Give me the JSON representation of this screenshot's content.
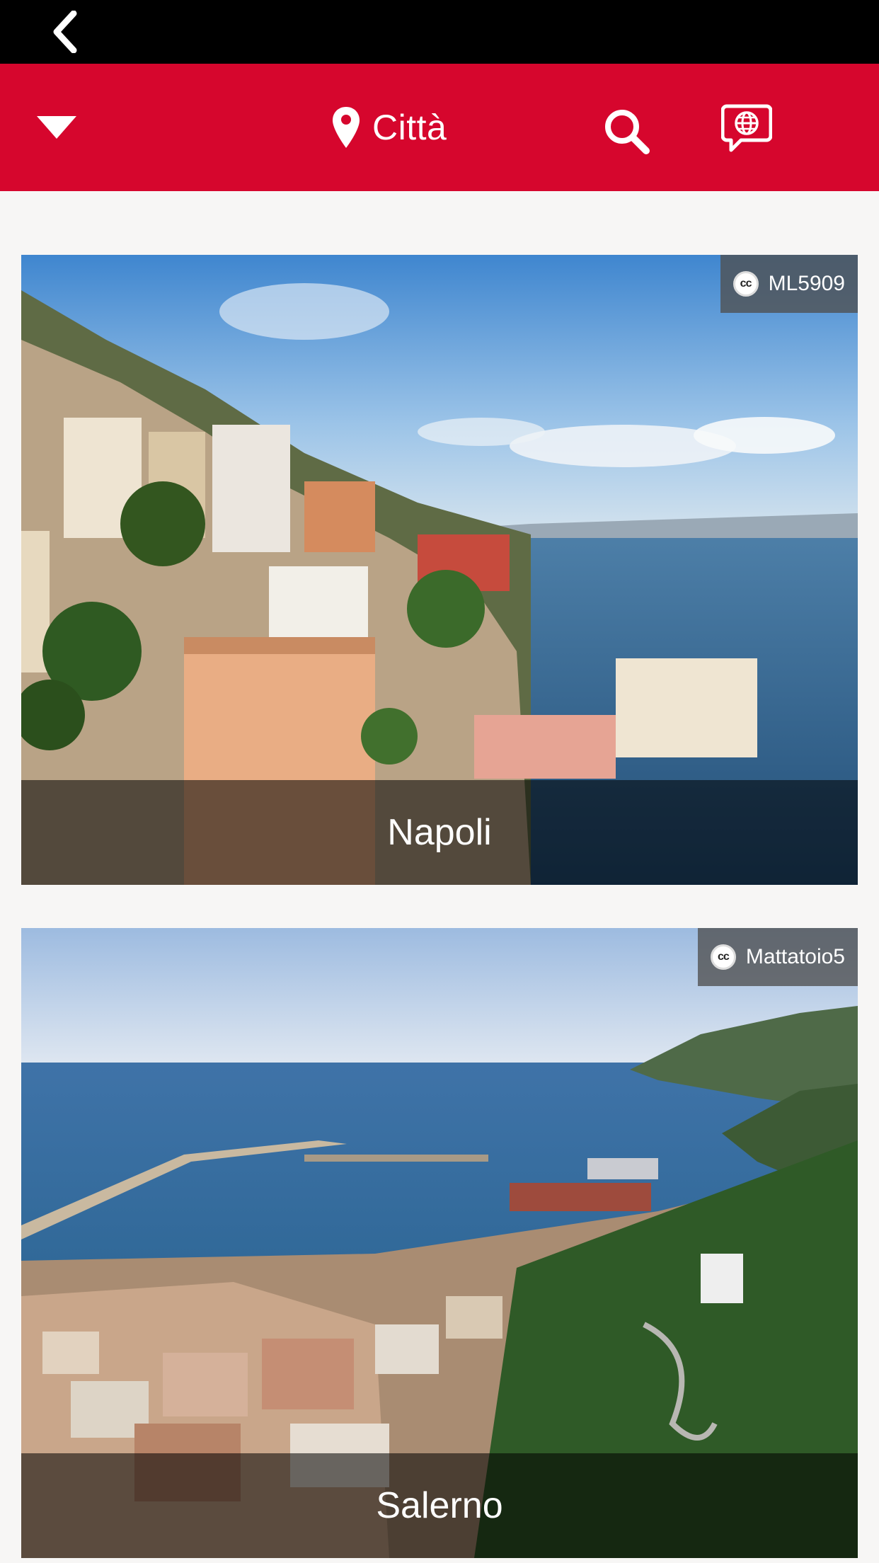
{
  "header": {
    "title": "Città"
  },
  "icons": {
    "back": "chevron-left-icon",
    "menu": "caret-down-icon",
    "location": "map-pin-icon",
    "search": "search-icon",
    "language": "globe-chat-icon"
  },
  "colors": {
    "brand_red": "#d6062d",
    "status_bar": "#000000"
  },
  "cities": [
    {
      "name": "Napoli",
      "credit": "ML5909"
    },
    {
      "name": "Salerno",
      "credit": "Mattatoio5"
    }
  ]
}
